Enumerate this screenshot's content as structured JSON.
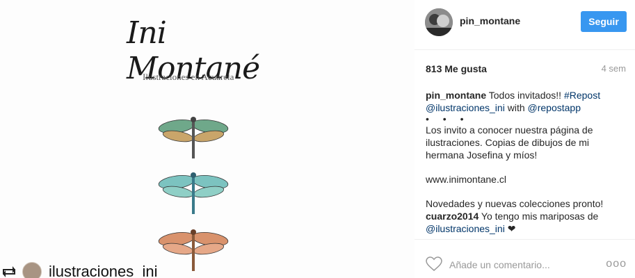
{
  "image": {
    "logo_text": "Ini Montané",
    "subtitle": "Ilustraciones en Acuarela",
    "repost_username": "ilustraciones_ini"
  },
  "header": {
    "username": "pin_montane",
    "follow_label": "Seguir"
  },
  "stats": {
    "likes": "813 Me gusta",
    "time_ago": "4 sem"
  },
  "caption": {
    "author": "pin_montane",
    "text1": " Todos invitados!! ",
    "hashtag": "#Repost",
    "mention1": "@ilustraciones_ini",
    "text2": " with ",
    "mention2": "@repostapp",
    "dots": "• • •",
    "paragraph1": "Los invito a conocer nuestra página de ilustraciones. Copias de dibujos de mi hermana Josefina y míos!",
    "website": "www.inimontane.cl",
    "paragraph2": "Novedades y nuevas colecciones pronto!"
  },
  "comment": {
    "author": "cuarzo2014",
    "text": " Yo tengo mis mariposas de ",
    "mention": "@ilustraciones_ini",
    "emoji": " ❤"
  },
  "footer": {
    "comment_placeholder": "Añade un comentario...",
    "more_label": "ooo"
  },
  "colors": {
    "accent": "#3897f0",
    "link": "#003569",
    "muted": "#999999"
  }
}
